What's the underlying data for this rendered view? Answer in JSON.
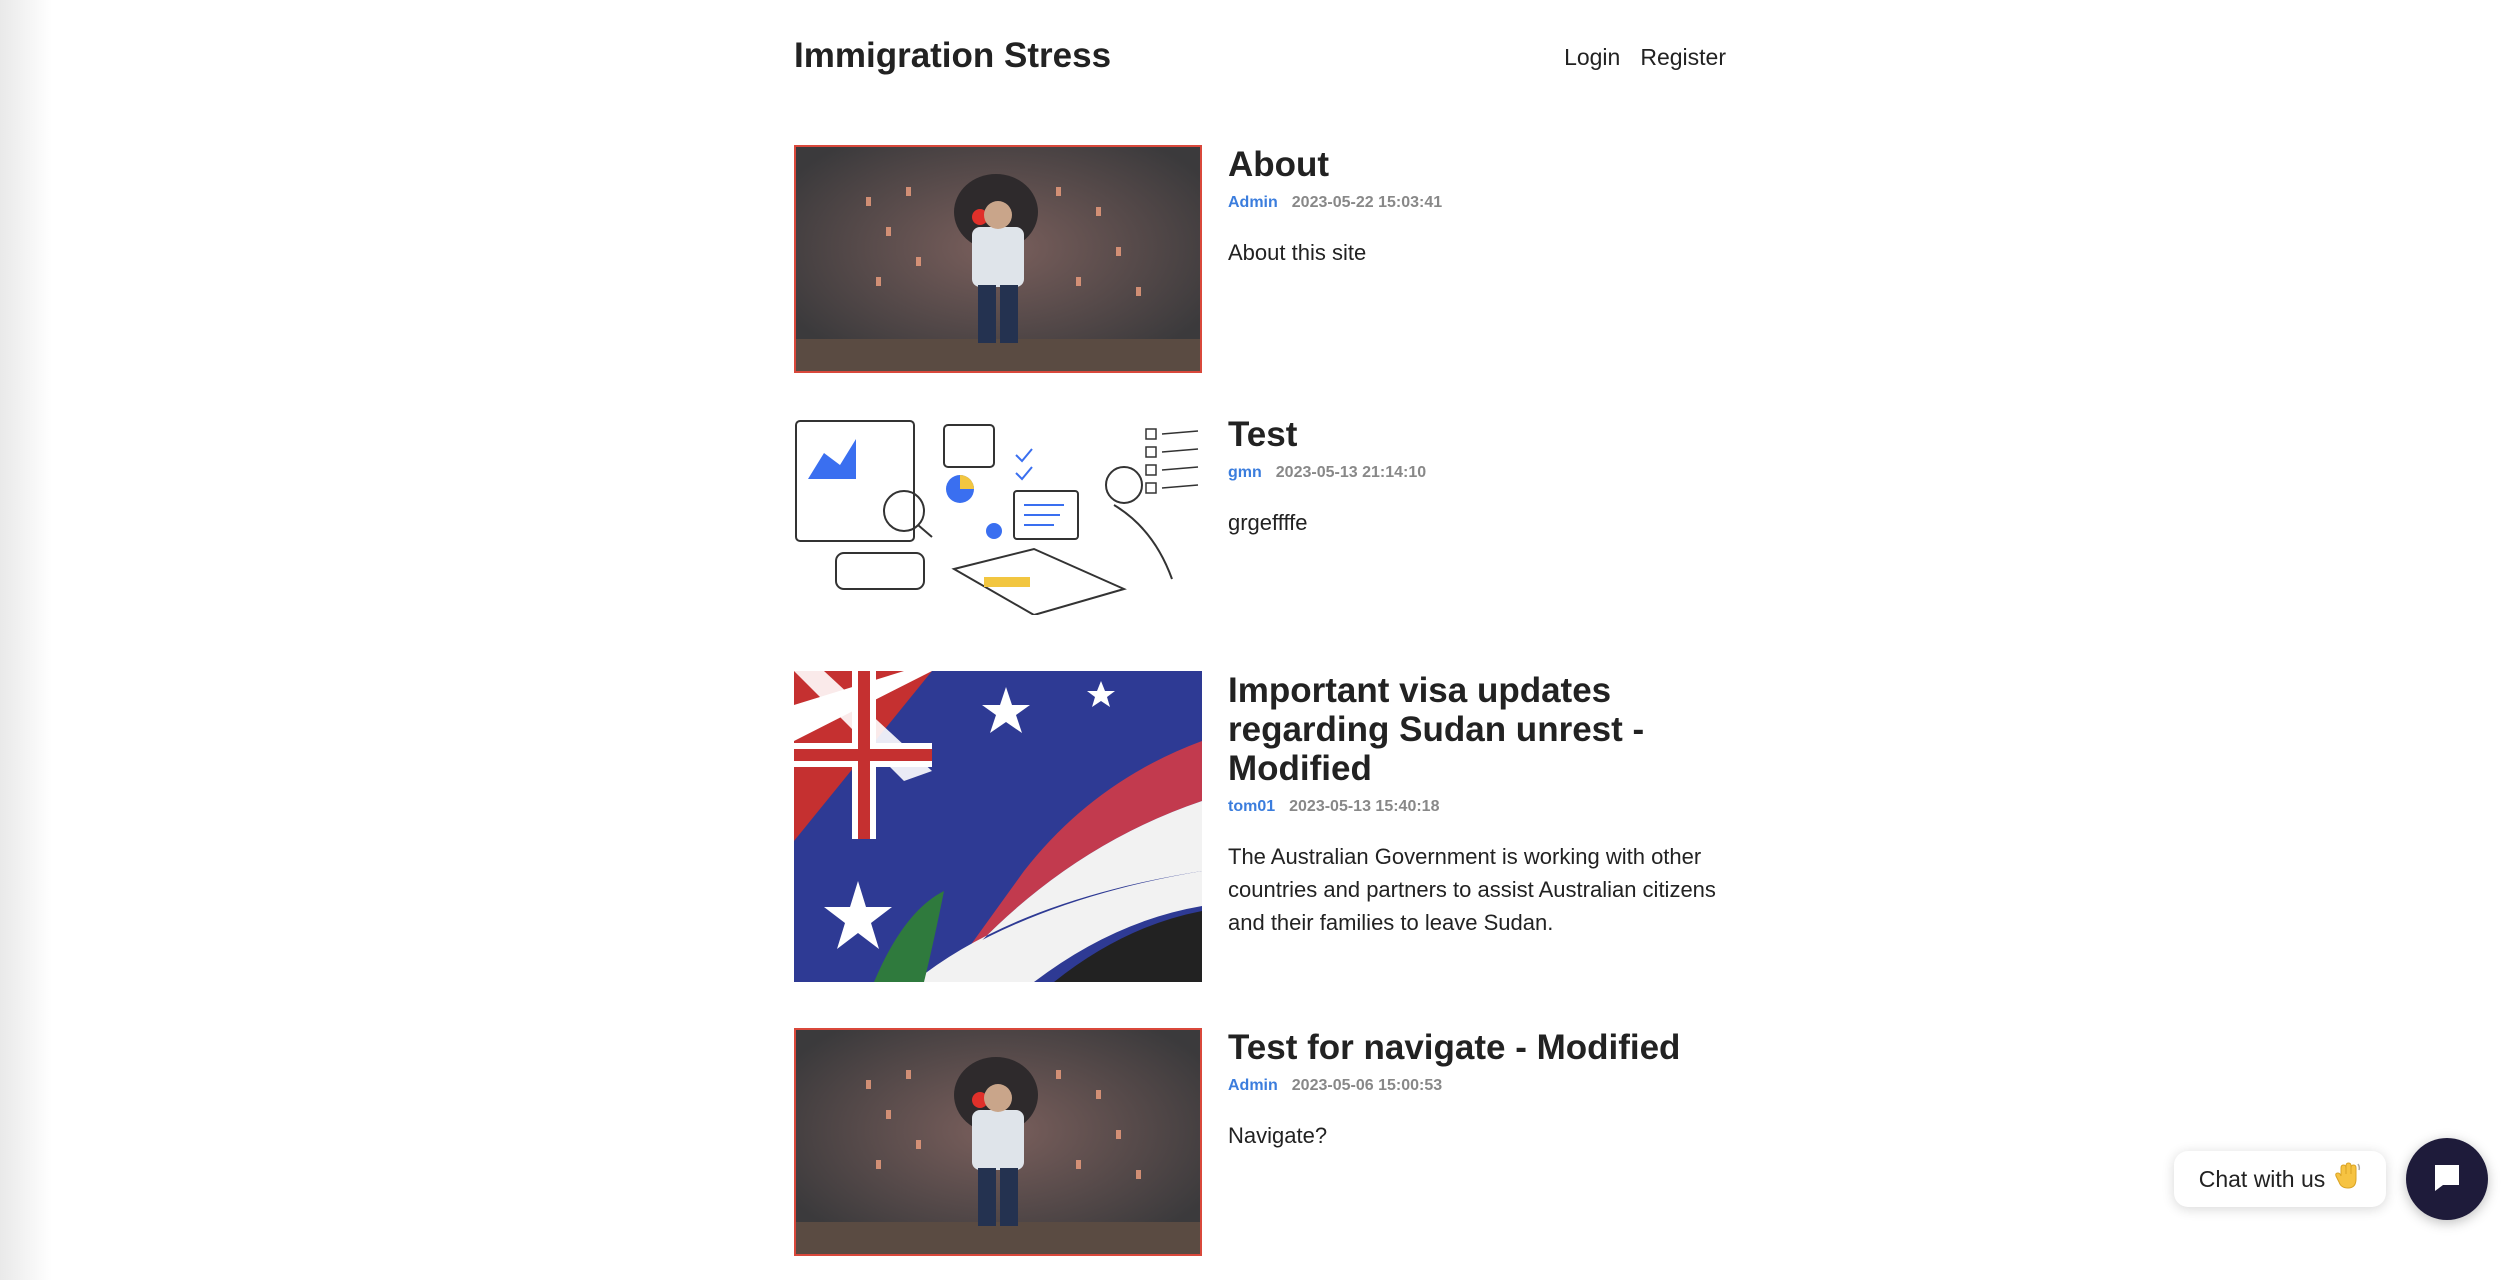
{
  "site": {
    "title": "Immigration Stress"
  },
  "nav": {
    "login": "Login",
    "register": "Register"
  },
  "posts": [
    {
      "title": "About",
      "author": "Admin",
      "date": "2023-05-22 15:03:41",
      "excerpt": "About this site",
      "image": "man-facing-robot-head-illustration"
    },
    {
      "title": "Test",
      "author": "gmn",
      "date": "2023-05-13 21:14:10",
      "excerpt": "grgeffffe",
      "image": "person-at-laptop-with-dashboards-sketch"
    },
    {
      "title": "Important visa updates regarding Sudan unrest - Modified",
      "author": "tom01",
      "date": "2023-05-13 15:40:18",
      "excerpt": "The Australian Government is working with other countries and partners to assist Australian citizens and their families to leave Sudan.",
      "image": "australia-and-sudan-flags"
    },
    {
      "title": "Test for navigate - Modified",
      "author": "Admin",
      "date": "2023-05-06 15:00:53",
      "excerpt": "Navigate?",
      "image": "man-facing-robot-head-illustration"
    }
  ],
  "chat": {
    "label": "Chat with us",
    "icon": "wave-hand-icon",
    "button_icon": "chat-bubble-icon",
    "button_color": "#1e1b3a"
  },
  "colors": {
    "link": "#3b7ddd",
    "meta": "#888888",
    "text": "#222222"
  }
}
